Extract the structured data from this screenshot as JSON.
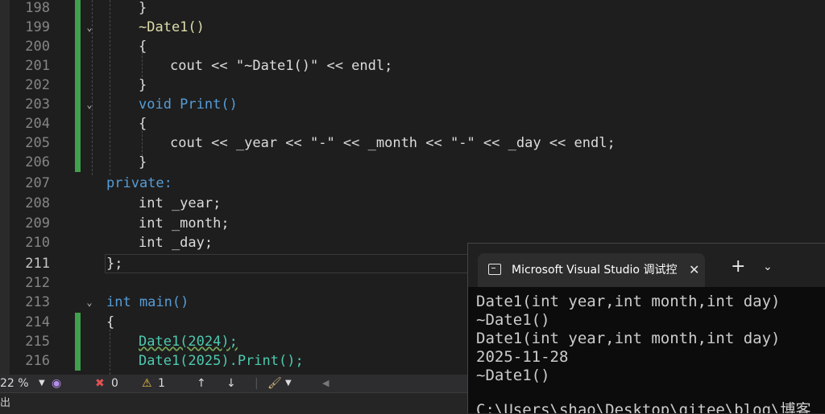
{
  "editor": {
    "lines": [
      {
        "n": "198",
        "t": "}"
      },
      {
        "n": "199",
        "t": "~Date1()"
      },
      {
        "n": "200",
        "t": "{"
      },
      {
        "n": "201",
        "t": "cout << \"~Date1()\" << endl;"
      },
      {
        "n": "202",
        "t": "}"
      },
      {
        "n": "203",
        "t": "void Print()"
      },
      {
        "n": "204",
        "t": "{"
      },
      {
        "n": "205",
        "t": "cout << _year << \"-\" << _month << \"-\" << _day << endl;"
      },
      {
        "n": "206",
        "t": "}"
      },
      {
        "n": "207",
        "t": "private:"
      },
      {
        "n": "208",
        "t": "int _year;"
      },
      {
        "n": "209",
        "t": "int _month;"
      },
      {
        "n": "210",
        "t": "int _day;"
      },
      {
        "n": "211",
        "t": "};"
      },
      {
        "n": "212",
        "t": ""
      },
      {
        "n": "213",
        "t": "int main()"
      },
      {
        "n": "214",
        "t": "{"
      },
      {
        "n": "215",
        "t": "Date1(2024);"
      },
      {
        "n": "216",
        "t": "Date1(2025).Print();"
      }
    ]
  },
  "status": {
    "zoom": "22 %",
    "errors": "0",
    "warnings": "1"
  },
  "bottom": {
    "label": "出"
  },
  "terminal": {
    "tab_title": "Microsoft Visual Studio 调试控",
    "output": [
      "Date1(int year,int month,int day)",
      "~Date1()",
      "Date1(int year,int month,int day)",
      "2025-11-28",
      "~Date1()",
      "",
      "C:\\Users\\shao\\Desktop\\gitee\\blog\\博客"
    ]
  },
  "colors": {
    "keyword": "#569cd6",
    "function": "#dcdcaa",
    "type": "#4ec9b0",
    "string": "#d69d85",
    "modified": "#3fa14b"
  }
}
